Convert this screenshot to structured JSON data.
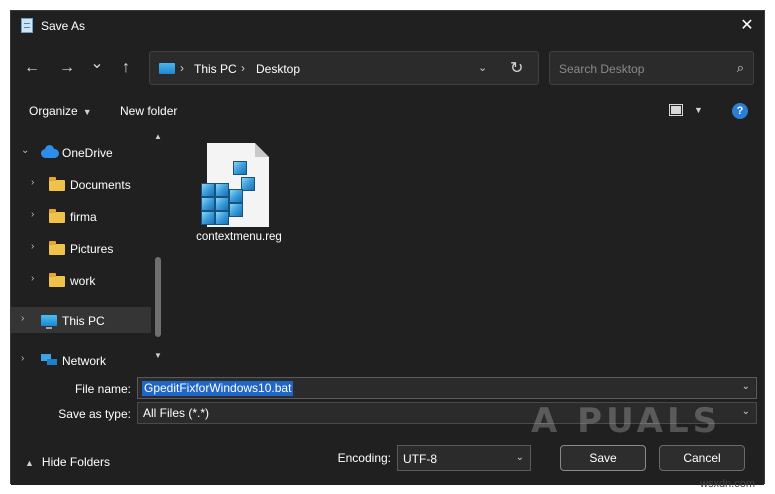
{
  "window": {
    "title": "Save As",
    "close_glyph": "✕"
  },
  "nav": {
    "back_glyph": "←",
    "forward_glyph": "→",
    "recent_glyph": "⌄",
    "up_glyph": "↑",
    "breadcrumb": [
      "This PC",
      "Desktop"
    ],
    "breadcrumb_separator": "›",
    "address_dropdown_glyph": "⌄",
    "refresh_glyph": "↻"
  },
  "search": {
    "placeholder": "Search Desktop",
    "icon": "⌕"
  },
  "toolbar": {
    "organize_label": "Organize",
    "organize_caret": "▼",
    "new_folder_label": "New folder",
    "view_caret": "▼",
    "help_glyph": "?"
  },
  "sidebar": {
    "expanded_glyph": "⌄",
    "collapsed_glyph": "›",
    "items": [
      {
        "label": "OneDrive",
        "icon": "cloud-icon",
        "expanded": true
      },
      {
        "label": "Documents",
        "icon": "folder-icon"
      },
      {
        "label": "firma",
        "icon": "folder-icon"
      },
      {
        "label": "Pictures",
        "icon": "folder-icon"
      },
      {
        "label": "work",
        "icon": "folder-icon"
      },
      {
        "label": "This PC",
        "icon": "monitor-icon",
        "selected": true
      },
      {
        "label": "Network",
        "icon": "network-icon"
      }
    ],
    "scroll_up_glyph": "▲",
    "scroll_down_glyph": "▼"
  },
  "files": [
    {
      "name": "contextmenu.reg",
      "icon": "registry-file-icon"
    }
  ],
  "form": {
    "file_name_label": "File name:",
    "file_name_value": "GpeditFixforWindows10.bat",
    "save_as_type_label": "Save as type:",
    "save_as_type_value": "All Files  (*.*)",
    "encoding_label": "Encoding:",
    "encoding_value": "UTF-8",
    "dropdown_glyph": "⌄"
  },
  "footer": {
    "hide_folders_label": "Hide Folders",
    "hide_folders_glyph": "▲",
    "save_label": "Save",
    "cancel_label": "Cancel"
  },
  "watermark": {
    "text": "A PUALS",
    "site": "wsxdn.com"
  }
}
